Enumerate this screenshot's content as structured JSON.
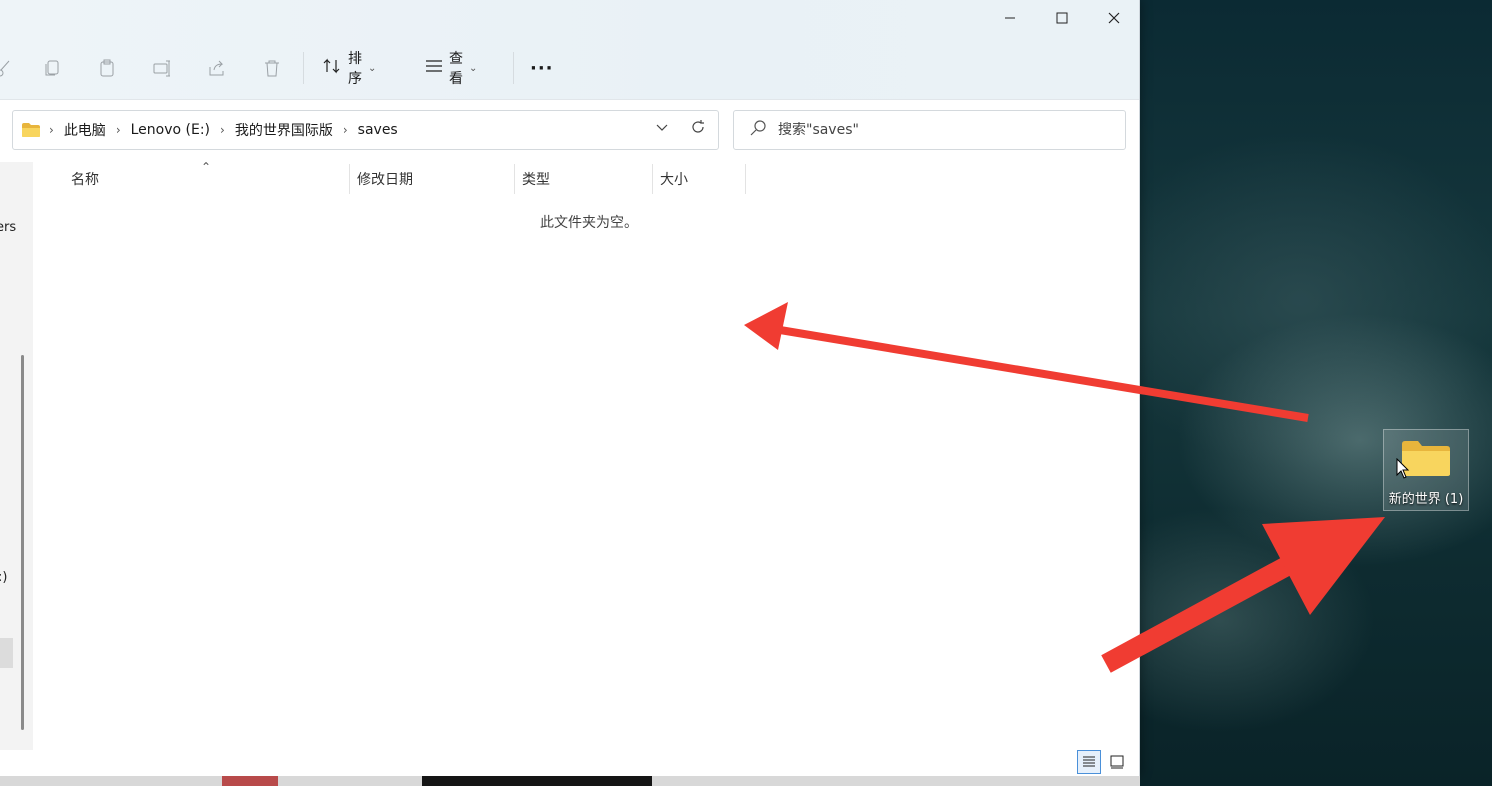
{
  "window": {
    "controls": {
      "minimize": "—",
      "maximize": "☐",
      "close": "✕"
    },
    "toolbar": {
      "sort_label": "排序",
      "view_label": "查看",
      "more_label": "···"
    },
    "address": {
      "crumbs": [
        "此电脑",
        "Lenovo (E:)",
        "我的世界国际版",
        "saves"
      ]
    },
    "search": {
      "placeholder": "搜索\"saves\""
    },
    "columns": {
      "name": "名称",
      "modified": "修改日期",
      "type": "类型",
      "size": "大小"
    },
    "empty_message": "此文件夹为空。",
    "nav_fragments": {
      "f1": "ers",
      "f2": ":)"
    }
  },
  "desktop": {
    "icon_label": "新的世界 (1)"
  },
  "colors": {
    "arrow": "#f03c32",
    "folder": "#f5c542"
  }
}
